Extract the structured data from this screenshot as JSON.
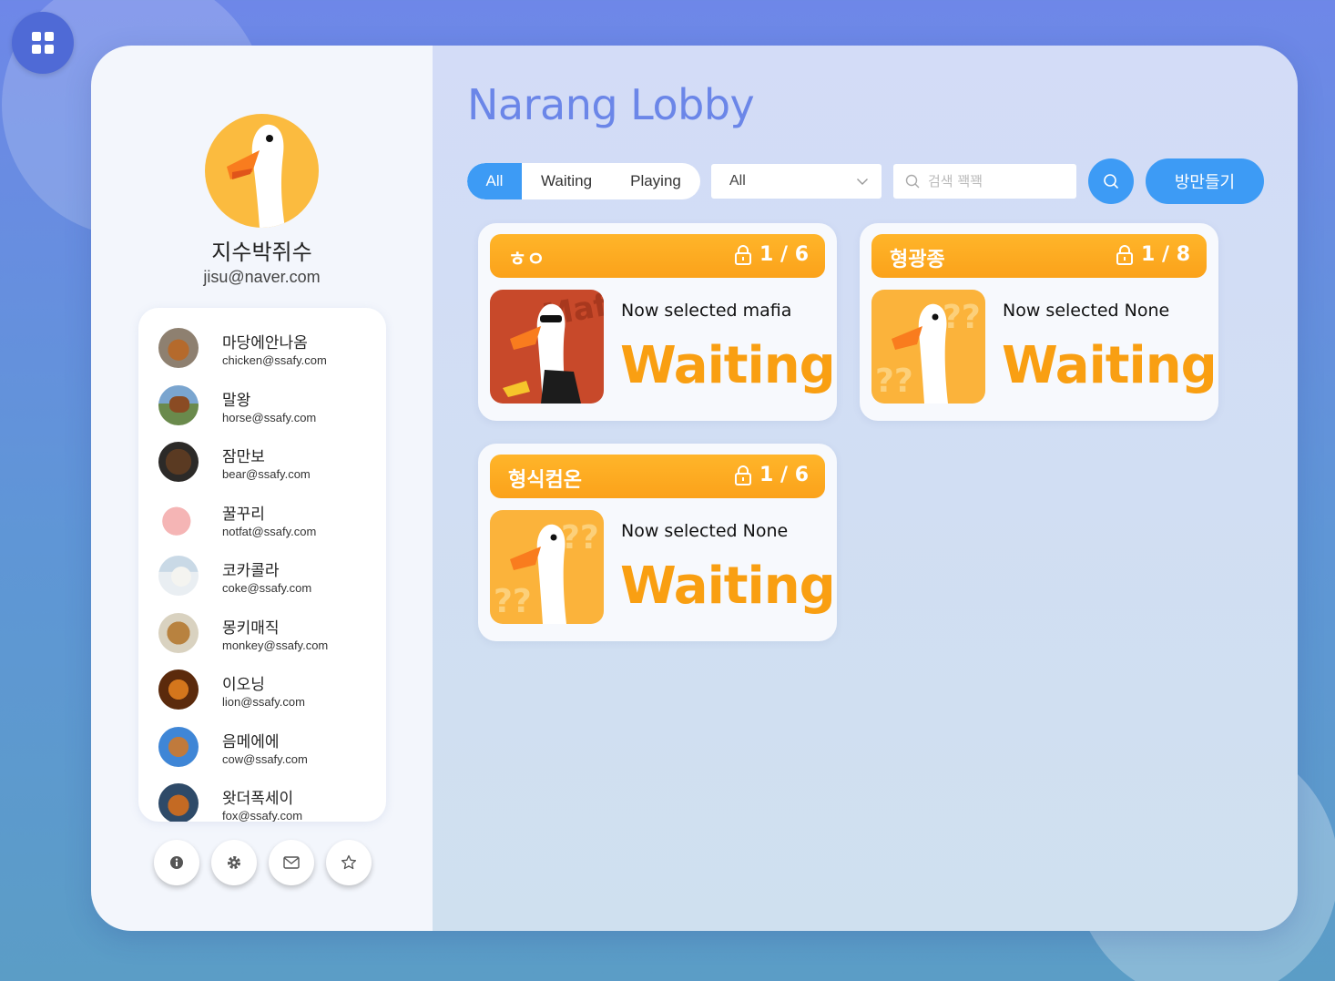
{
  "app": {
    "lobby_title": "Narang Lobby",
    "accent_color": "#3d9bf5",
    "room_color": "#fba21a"
  },
  "profile": {
    "name": "지수박쥐수",
    "email": "jisu@naver.com",
    "avatar_icon": "goose-icon"
  },
  "friends": [
    {
      "name": "마당에안나옴",
      "email": "chicken@ssafy.com",
      "avatar": "chicken-avatar"
    },
    {
      "name": "말왕",
      "email": "horse@ssafy.com",
      "avatar": "horse-avatar"
    },
    {
      "name": "잠만보",
      "email": "bear@ssafy.com",
      "avatar": "bear-avatar"
    },
    {
      "name": "꿀꾸리",
      "email": "notfat@ssafy.com",
      "avatar": "pig-avatar"
    },
    {
      "name": "코카콜라",
      "email": "coke@ssafy.com",
      "avatar": "polar-bear-avatar"
    },
    {
      "name": "몽키매직",
      "email": "monkey@ssafy.com",
      "avatar": "monkey-avatar"
    },
    {
      "name": "이오닝",
      "email": "lion@ssafy.com",
      "avatar": "lion-avatar"
    },
    {
      "name": "음메에에",
      "email": "cow@ssafy.com",
      "avatar": "cow-avatar"
    },
    {
      "name": "왓더폭세이",
      "email": "fox@ssafy.com",
      "avatar": "fox-avatar"
    }
  ],
  "sidebar_buttons": [
    "info-icon",
    "gear-icon",
    "mail-icon",
    "star-icon"
  ],
  "filters": {
    "tabs": [
      "All",
      "Waiting",
      "Playing"
    ],
    "active_tab": "All",
    "select_value": "All",
    "search_placeholder": "검색 꽥꽥",
    "create_label": "방만들기"
  },
  "rooms": [
    {
      "title": "ㅎㅇ",
      "count": "1 / 6",
      "selected": "Now selected mafia",
      "status": "Waiting",
      "image": "mafia-goose"
    },
    {
      "title": "형광종",
      "count": "1 / 8",
      "selected": "Now selected None",
      "status": "Waiting",
      "image": "question-goose"
    },
    {
      "title": "형식컴온",
      "count": "1 / 6",
      "selected": "Now selected None",
      "status": "Waiting",
      "image": "question-goose"
    }
  ]
}
